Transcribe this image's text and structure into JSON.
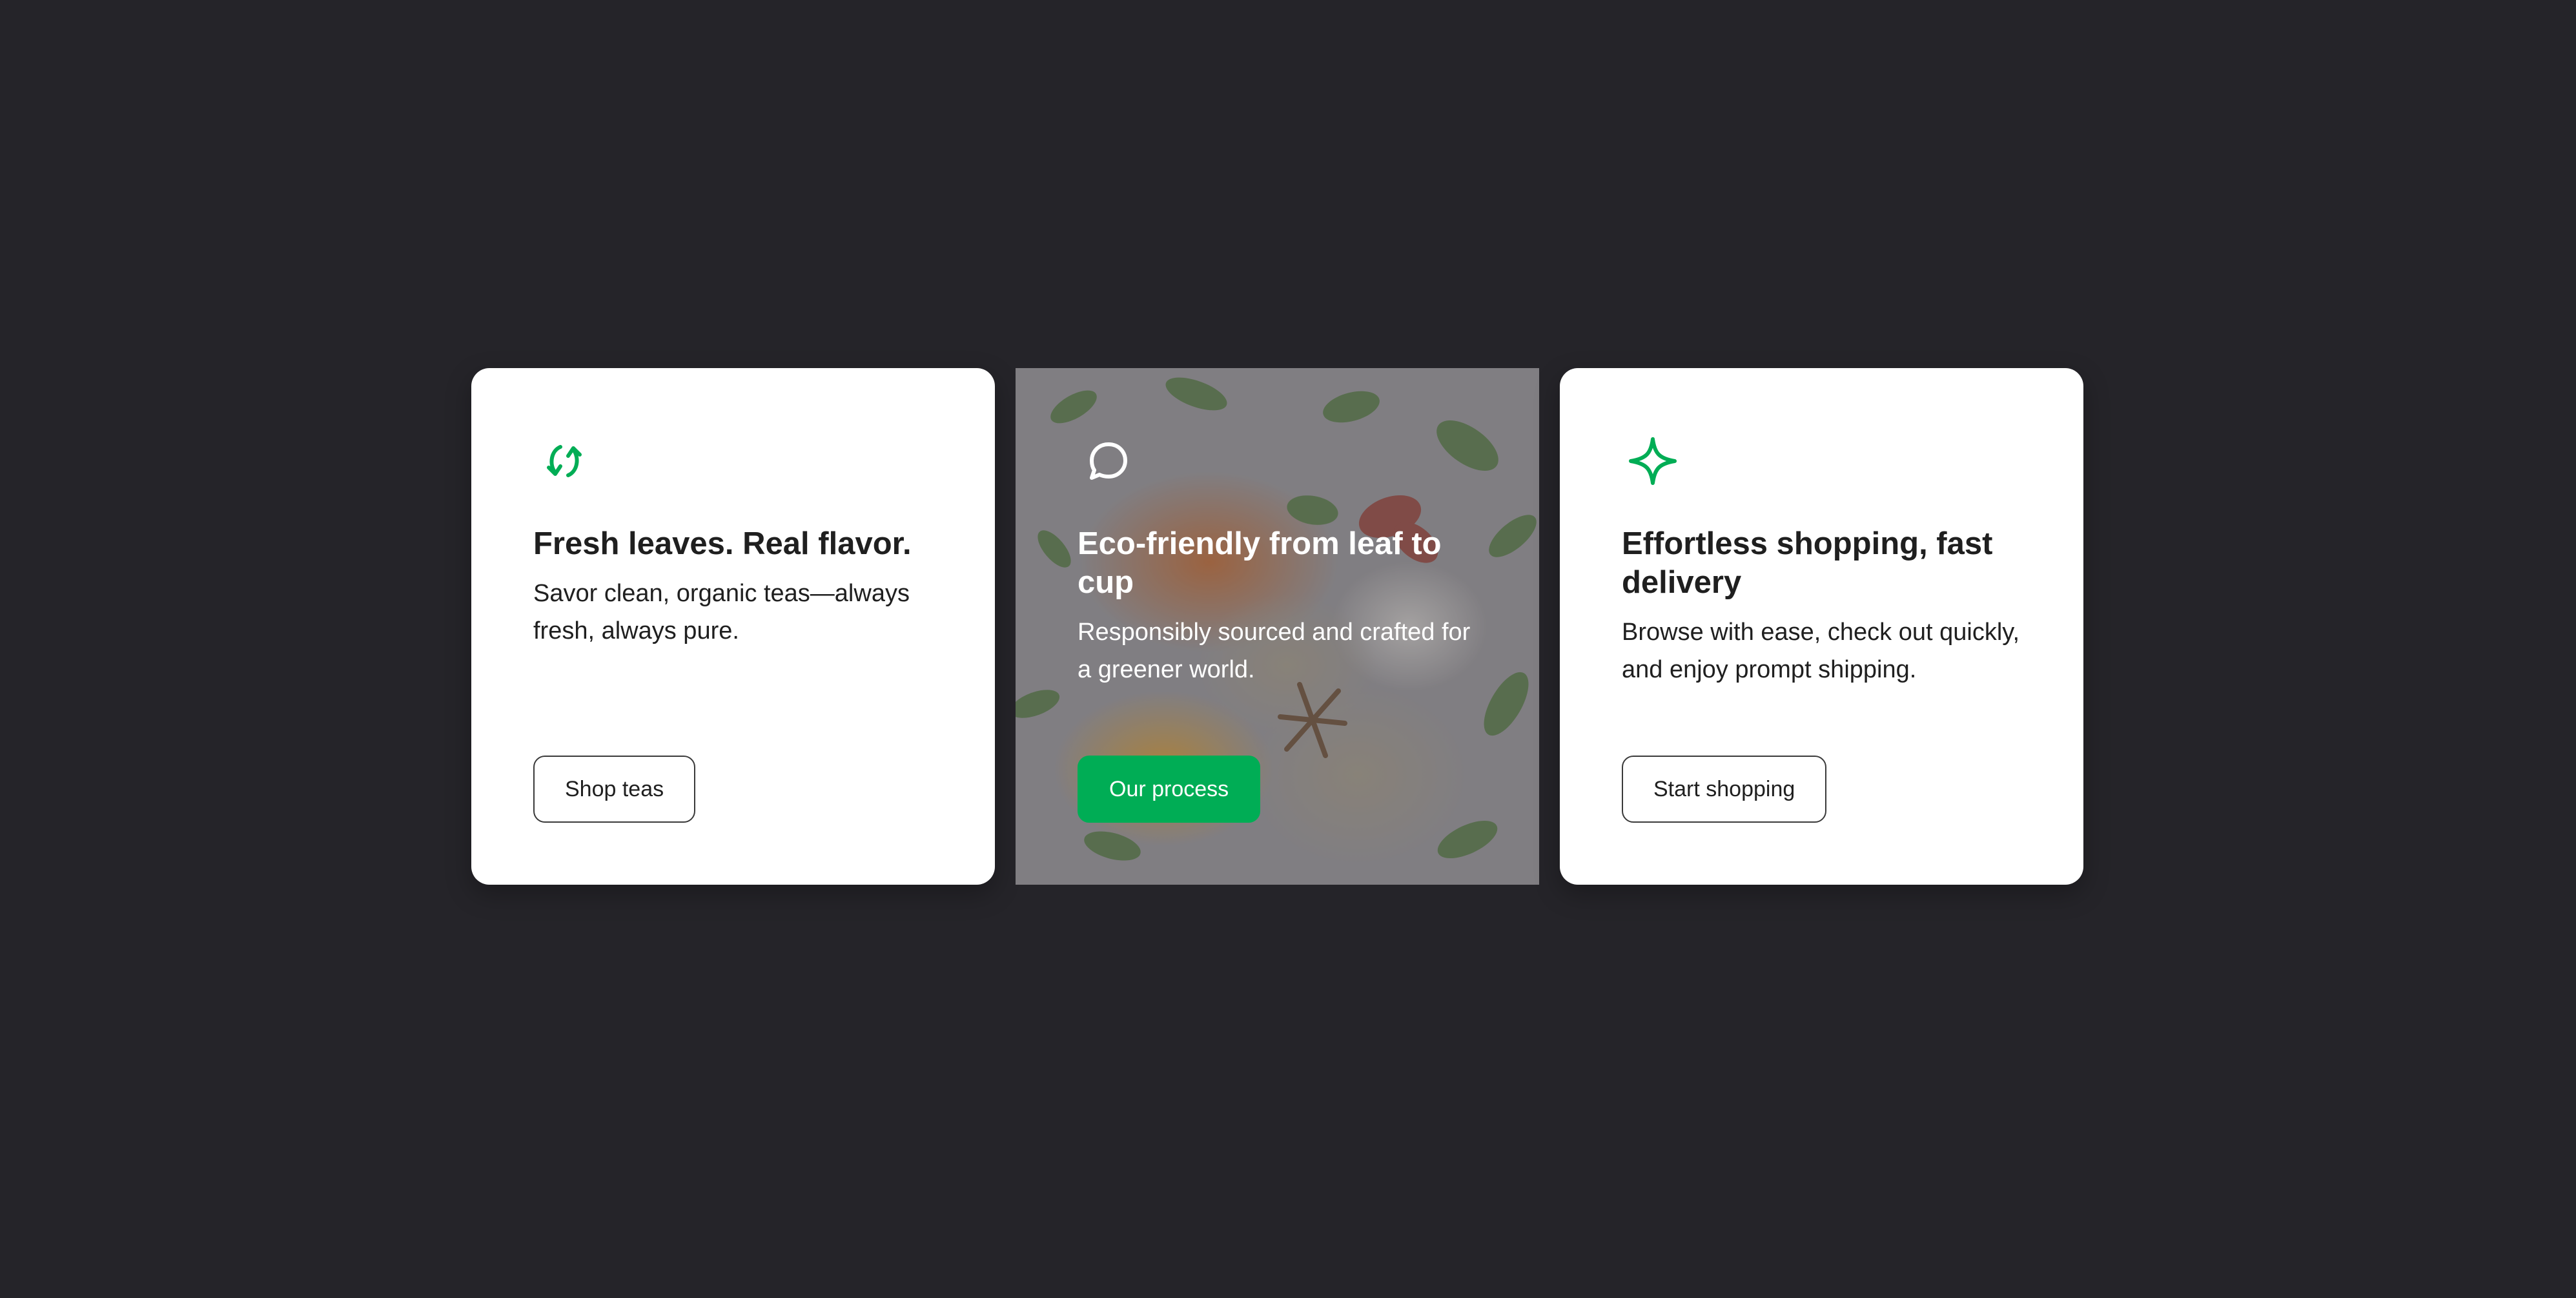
{
  "colors": {
    "page_background": "#252429",
    "card_background": "#ffffff",
    "accent_green": "#00ad55",
    "text_dark": "#1f1f1f",
    "text_light": "#ffffff"
  },
  "cards": [
    {
      "icon": "refresh-arrows-icon",
      "title": "Fresh leaves. Real flavor.",
      "description": "Savor clean, organic teas—always fresh, always pure.",
      "button_label": "Shop teas",
      "button_style": "outline"
    },
    {
      "icon": "chat-bubble-icon",
      "background_image": "spices-and-herbs-photo",
      "title": "Eco-friendly from leaf to cup",
      "description": "Responsibly sourced and crafted for a greener world.",
      "button_label": "Our process",
      "button_style": "solid"
    },
    {
      "icon": "sparkle-icon",
      "title": "Effortless shopping, fast delivery",
      "description": "Browse with ease, check out quickly, and enjoy prompt shipping.",
      "button_label": "Start shopping",
      "button_style": "outline"
    }
  ]
}
